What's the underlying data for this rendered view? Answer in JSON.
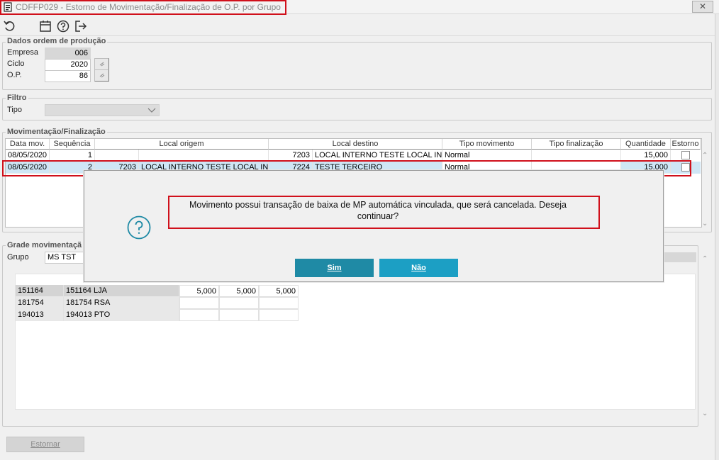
{
  "window": {
    "title": "CDFFP029 - Estorno de Movimentação/Finalização de O.P. por Grupo",
    "close": "✕"
  },
  "toolbar": {
    "icons": [
      "undo-icon",
      "calendar-icon",
      "help-icon",
      "exit-icon"
    ]
  },
  "dados": {
    "title": "Dados ordem de produção",
    "empresa_label": "Empresa",
    "empresa_value": "006",
    "ciclo_label": "Ciclo",
    "ciclo_value": "2020",
    "op_label": "O.P.",
    "op_value": "86"
  },
  "filtro": {
    "title": "Filtro",
    "tipo_label": "Tipo",
    "tipo_value": ""
  },
  "movimentacao": {
    "title": "Movimentação/Finalização",
    "columns": [
      "Data mov.",
      "Sequência",
      "Local origem",
      "Local destino",
      "Tipo movimento",
      "Tipo finalização",
      "Quantidade",
      "Estorno"
    ],
    "rows": [
      {
        "data": "08/05/2020",
        "seq": "1",
        "orig_cod": "",
        "orig_desc": "",
        "dest_cod": "7203",
        "dest_desc": "LOCAL INTERNO TESTE LOCAL INTE",
        "tipo_mov": "Normal",
        "tipo_fin": "",
        "qtd": "15,000",
        "estorno": false
      },
      {
        "data": "08/05/2020",
        "seq": "2",
        "orig_cod": "7203",
        "orig_desc": "LOCAL INTERNO TESTE LOCAL INTE",
        "dest_cod": "7224",
        "dest_desc": "TESTE TERCEIRO",
        "tipo_mov": "Normal",
        "tipo_fin": "",
        "qtd": "15,000",
        "estorno": false
      }
    ]
  },
  "grade": {
    "title": "Grade movimentaçã",
    "grupo_label": "Grupo",
    "grupo_value": "MS TST",
    "rows": [
      {
        "cod": "151164",
        "desc": "151164 LJA",
        "v1": "5,000",
        "v2": "5,000",
        "v3": "5,000"
      },
      {
        "cod": "181754",
        "desc": "181754 RSA",
        "v1": "",
        "v2": "",
        "v3": ""
      },
      {
        "cod": "194013",
        "desc": "194013 PTO",
        "v1": "",
        "v2": "",
        "v3": ""
      }
    ]
  },
  "dialog": {
    "message": "Movimento possui transação de baixa de MP automática vinculada, que será cancelada. Deseja continuar?",
    "yes_label": "Sim",
    "no_label": "Não"
  },
  "footer": {
    "estornar_label": "Estornar"
  },
  "colors": {
    "accent": "#1f8aa5",
    "highlight": "#d0101b",
    "selected_row": "#cfe6f5"
  }
}
